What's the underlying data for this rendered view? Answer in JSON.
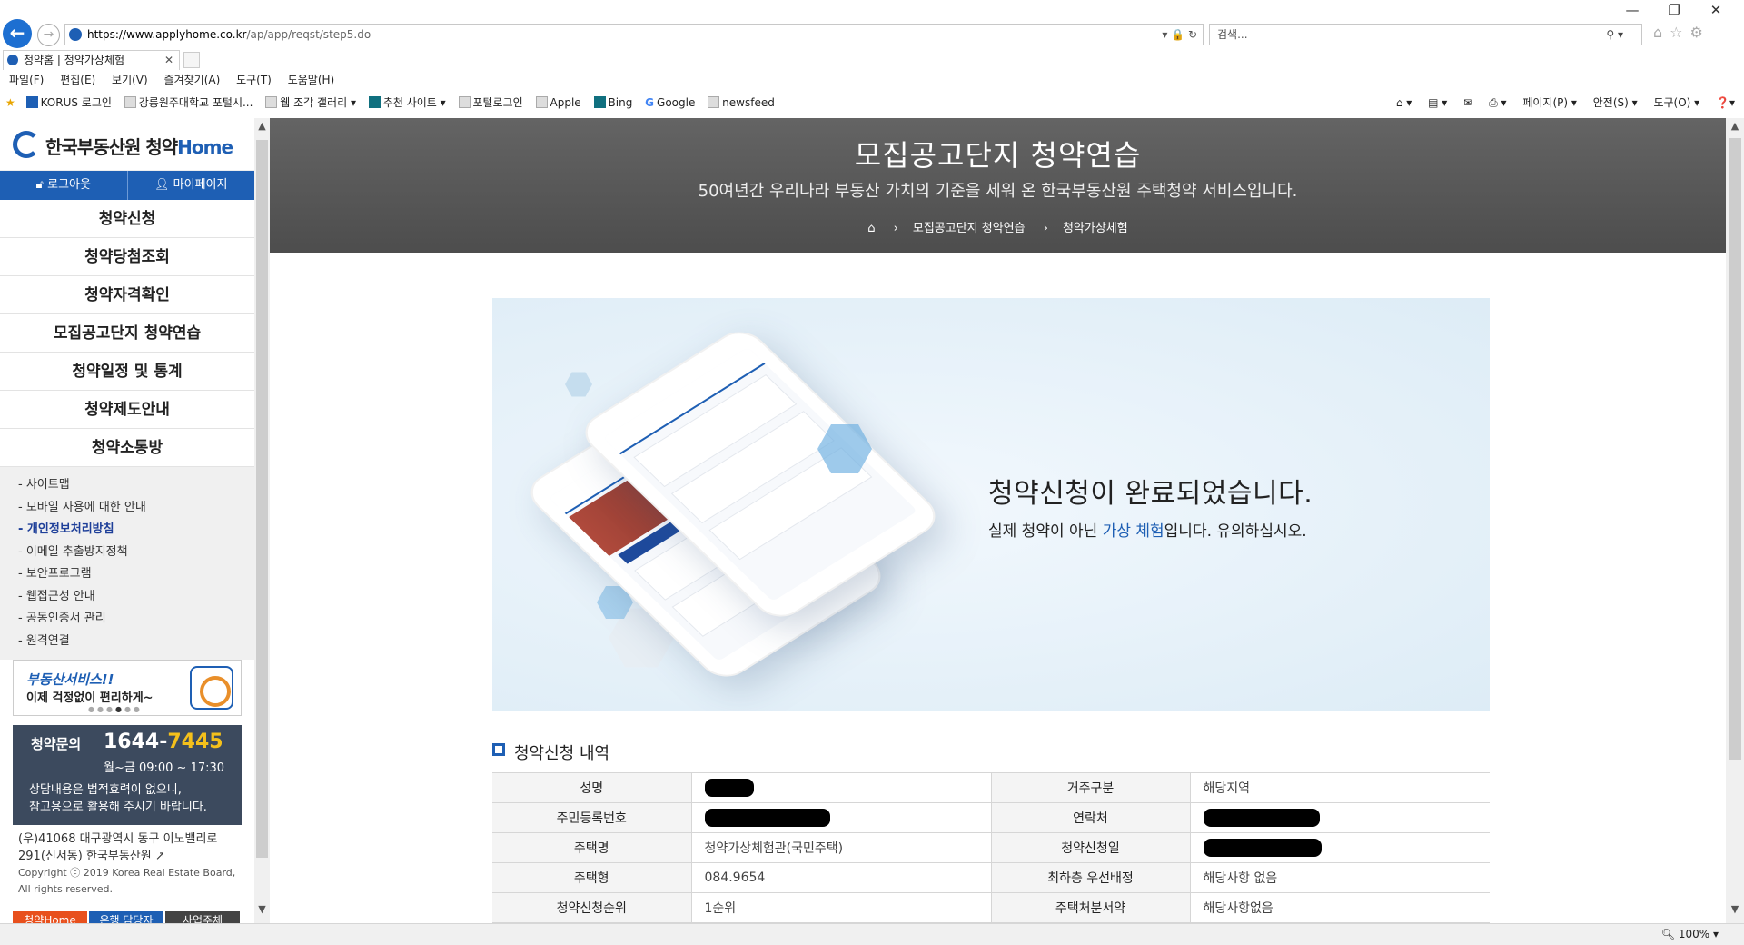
{
  "browser": {
    "url_host": "https://www.applyhome.co.kr",
    "url_path": "/ap/app/reqst/step5.do",
    "search_placeholder": "검색...",
    "tab_title": "청약홈 | 청약가상체험",
    "menu": [
      "파일(F)",
      "편집(E)",
      "보기(V)",
      "즐겨찾기(A)",
      "도구(T)",
      "도움말(H)"
    ],
    "favorites": [
      "KORUS 로그인",
      "강릉원주대학교 포털시...",
      "웹 조각 갤러리 ▾",
      "추천 사이트 ▾",
      "포털로그인",
      "Apple",
      "Bing",
      "Google",
      "newsfeed"
    ],
    "toolbar_right": [
      "페이지(P) ▾",
      "안전(S) ▾",
      "도구(O) ▾"
    ],
    "zoom": "100%"
  },
  "sidebar": {
    "logo_text": "한국부동산원 청약",
    "logo_home": "Home",
    "logout": "로그아웃",
    "mypage": "마이페이지",
    "nav": [
      "청약신청",
      "청약당첨조회",
      "청약자격확인",
      "모집공고단지 청약연습",
      "청약일정 및 통계",
      "청약제도안내",
      "청약소통방"
    ],
    "links": [
      "- 사이트맵",
      "- 모바일 사용에 대한 안내",
      "- 개인정보처리방침",
      "- 이메일 추출방지정책",
      "- 보안프로그램",
      "- 웹접근성 안내",
      "- 공동인증서 관리",
      "- 원격연결"
    ],
    "banner_title": "부동산서비스!!",
    "banner_sub": "이제 걱정없이 편리하게~",
    "call_label": "청약문의",
    "call_num_a": "1644-",
    "call_num_b": "7445",
    "call_hours": "월~금 09:00 ~ 17:30",
    "call_note_1": "상담내용은 법적효력이 없으니,",
    "call_note_2": "참고용으로 활용해 주시기 바랍니다.",
    "address_1": "(우)41068 대구광역시 동구 이노밸리로",
    "address_2": "291(신서동) 한국부동산원 ↗",
    "copyright_1": "Copyright ⓒ 2019 Korea Real Estate Board,",
    "copyright_2": "All rights reserved.",
    "bottom_btns": [
      "청약Home",
      "은행 담당자",
      "사업주체"
    ]
  },
  "hero": {
    "title": "모집공고단지 청약연습",
    "subtitle": "50여년간 우리나라 부동산 가치의 기준을 세워 온 한국부동산원 주택청약 서비스입니다.",
    "crumb_1": "모집공고단지 청약연습",
    "crumb_2": "청약가상체험"
  },
  "done": {
    "title": "청약신청이 완료되었습니다.",
    "sub_a": "실제 청약이 아닌 ",
    "sub_accent": "가상 체험",
    "sub_b": "입니다. 유의하십시오."
  },
  "details": {
    "title": "청약신청 내역",
    "rows": [
      {
        "l1": "성명",
        "v1": "",
        "l2": "거주구분",
        "v2": "해당지역"
      },
      {
        "l1": "주민등록번호",
        "v1": "",
        "l2": "연락처",
        "v2": ""
      },
      {
        "l1": "주택명",
        "v1": "청약가상체험관(국민주택)",
        "l2": "청약신청일",
        "v2": ""
      },
      {
        "l1": "주택형",
        "v1": "084.9654",
        "l2": "최하층 우선배정",
        "v2": "해당사항 없음"
      },
      {
        "l1": "청약신청순위",
        "v1": "1순위",
        "l2": "주택처분서약",
        "v2": "해당사항없음"
      }
    ]
  }
}
